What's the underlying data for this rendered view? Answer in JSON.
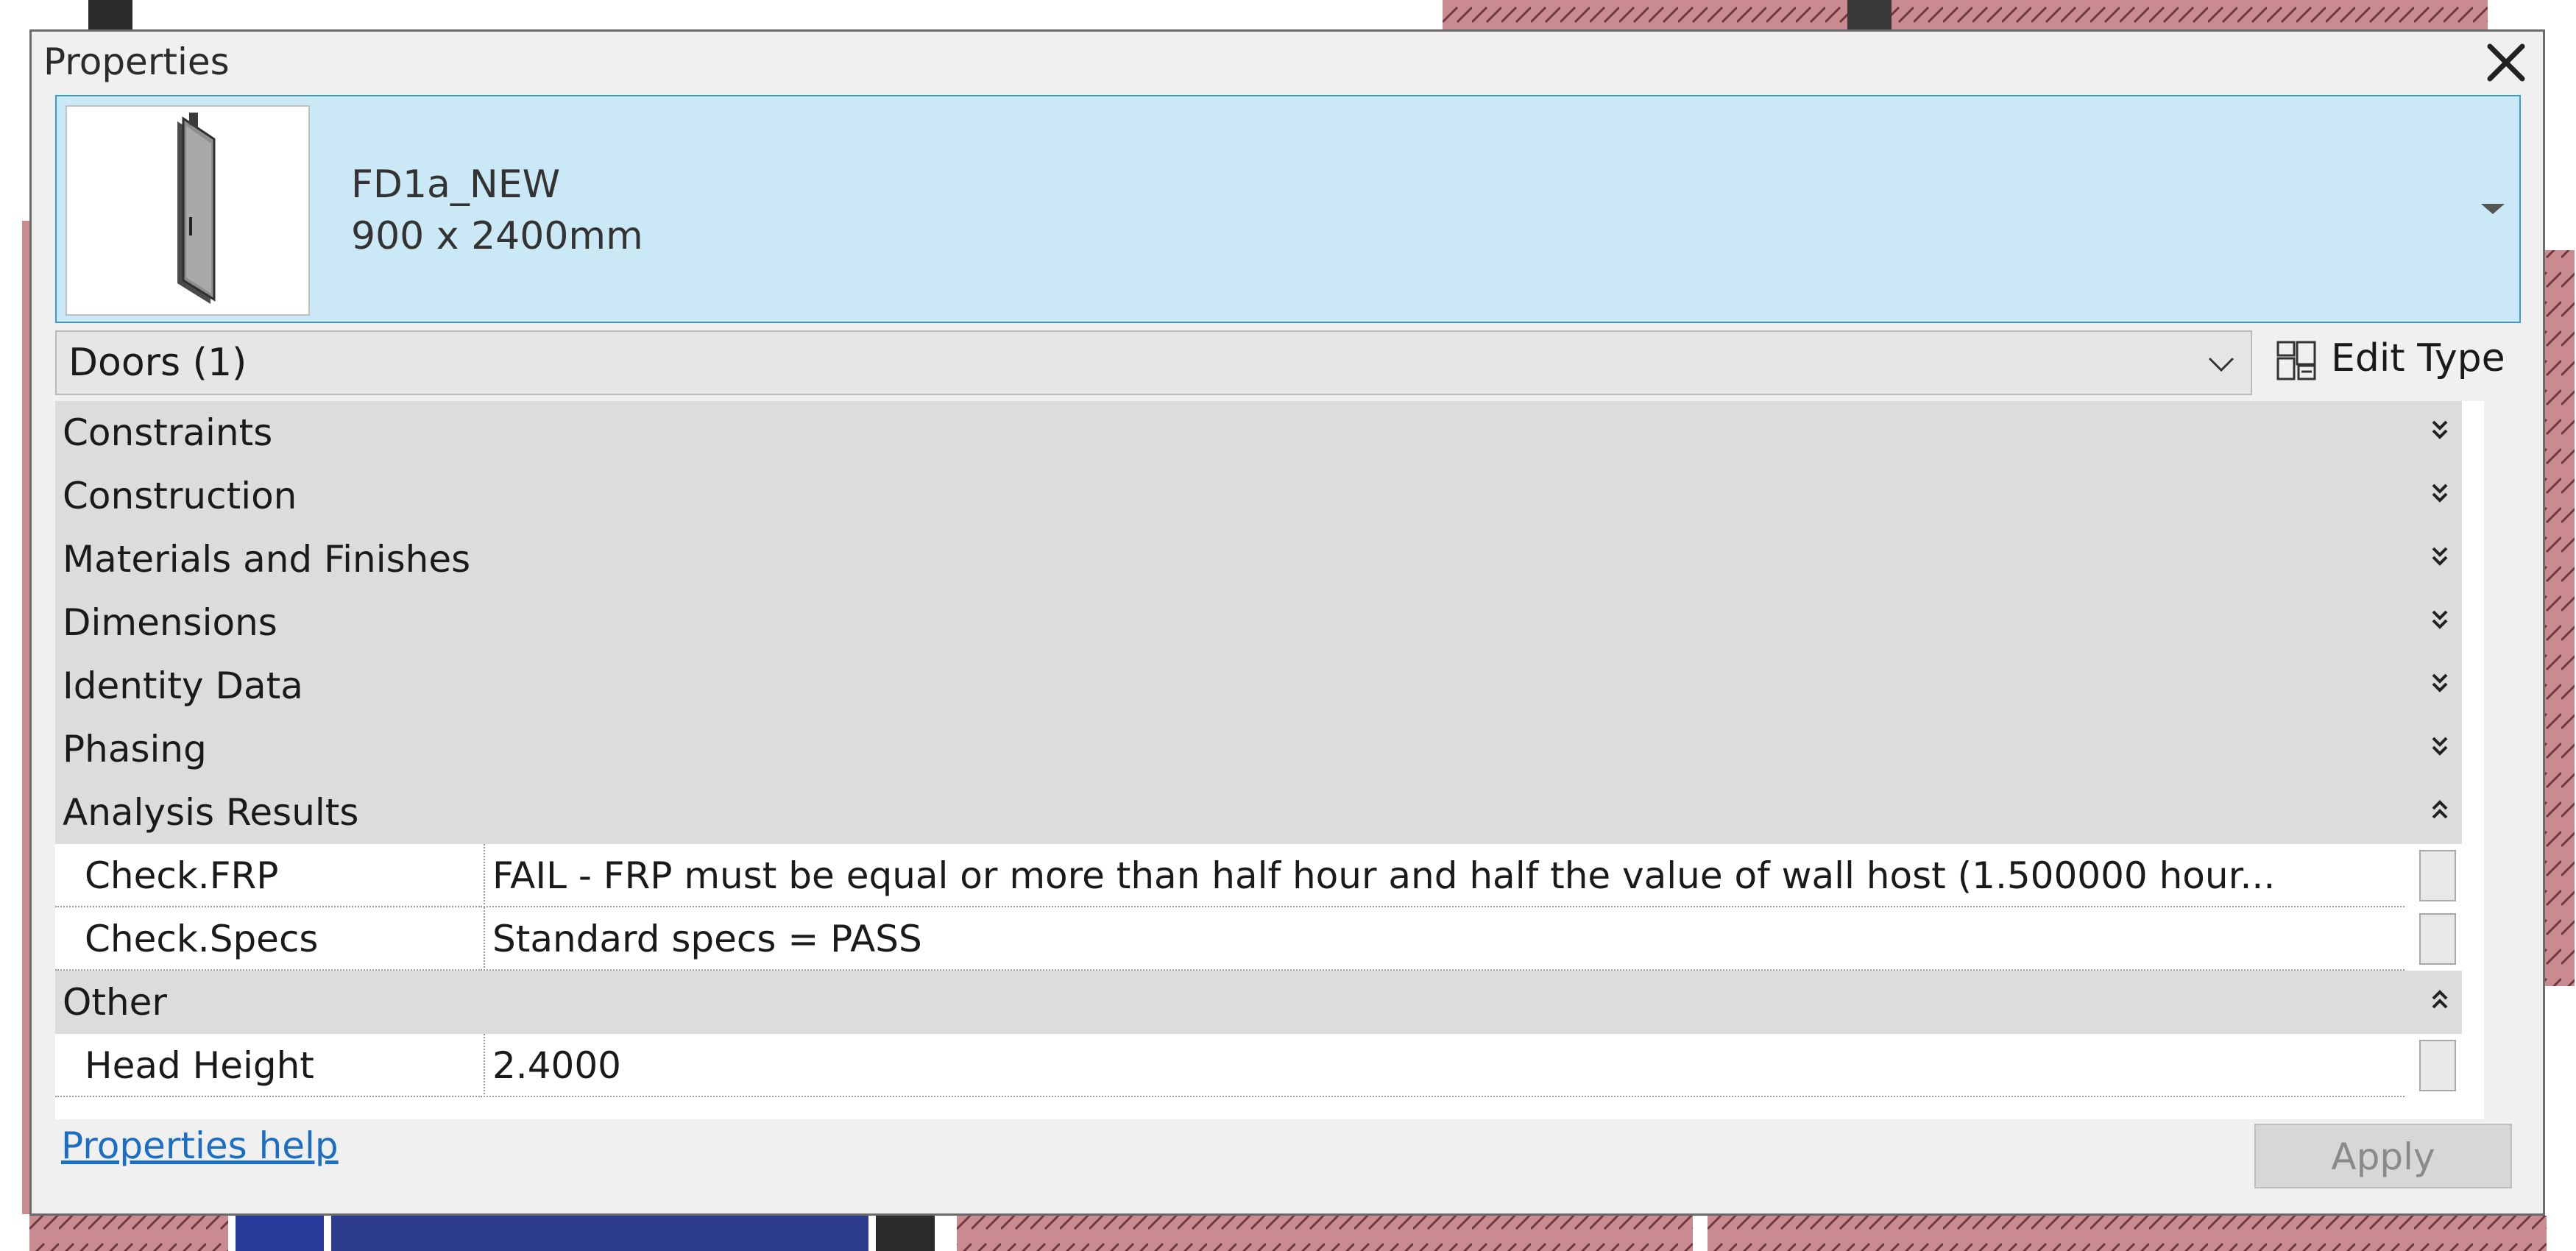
{
  "window": {
    "title": "Properties",
    "close_icon": "close-icon"
  },
  "type_selector": {
    "family": "FD1a_NEW",
    "type": "900 x 2400mm",
    "thumbnail_icon": "door-icon",
    "dropdown_icon": "triangle-down-icon"
  },
  "filter": {
    "label": "Doors (1)",
    "chevron_icon": "chevron-down-icon"
  },
  "edit_type": {
    "label": "Edit Type",
    "icon": "edit-type-icon"
  },
  "groups": [
    {
      "label": "Constraints",
      "expanded": false
    },
    {
      "label": "Construction",
      "expanded": false
    },
    {
      "label": "Materials and Finishes",
      "expanded": false
    },
    {
      "label": "Dimensions",
      "expanded": false
    },
    {
      "label": "Identity Data",
      "expanded": false
    },
    {
      "label": "Phasing",
      "expanded": false
    },
    {
      "label": "Analysis Results",
      "expanded": true,
      "properties": [
        {
          "name": "Check.FRP",
          "value": "FAIL - FRP must be equal or more than half hour and half the value of wall host (1.500000 hour..."
        },
        {
          "name": "Check.Specs",
          "value": "Standard specs = PASS"
        }
      ]
    },
    {
      "label": "Other",
      "expanded": true,
      "properties": [
        {
          "name": "Head Height",
          "value": "2.4000"
        }
      ]
    }
  ],
  "footer": {
    "help_link": "Properties help",
    "apply_label": "Apply",
    "apply_enabled": false
  },
  "colors": {
    "selector_background": "#cbe8f7",
    "group_header": "#dcdcdc",
    "link": "#1b6ec2"
  }
}
